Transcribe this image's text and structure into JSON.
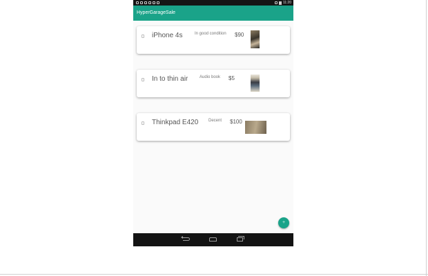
{
  "status_bar": {
    "time": "11:20"
  },
  "toolbar": {
    "title": "HyperGarageSale"
  },
  "items": [
    {
      "name": "iPhone 4s",
      "condition": "In good condition",
      "price": "$90",
      "thumb": "iphone-photo"
    },
    {
      "name": "In to thin air",
      "condition": "Audio book",
      "price": "$5",
      "thumb": "audiobook-photo"
    },
    {
      "name": "Thinkpad E420",
      "condition": "Decent",
      "price": "$100",
      "thumb": "laptop-photo"
    }
  ],
  "fab": {
    "icon": "add-icon",
    "label": "+"
  },
  "nav_bar": {
    "icons": [
      "back-icon",
      "home-icon",
      "recents-icon"
    ]
  },
  "colors": {
    "accent": "#1aa389",
    "status_bar": "#151515",
    "nav_bar": "#131313",
    "background": "#fafafa"
  }
}
